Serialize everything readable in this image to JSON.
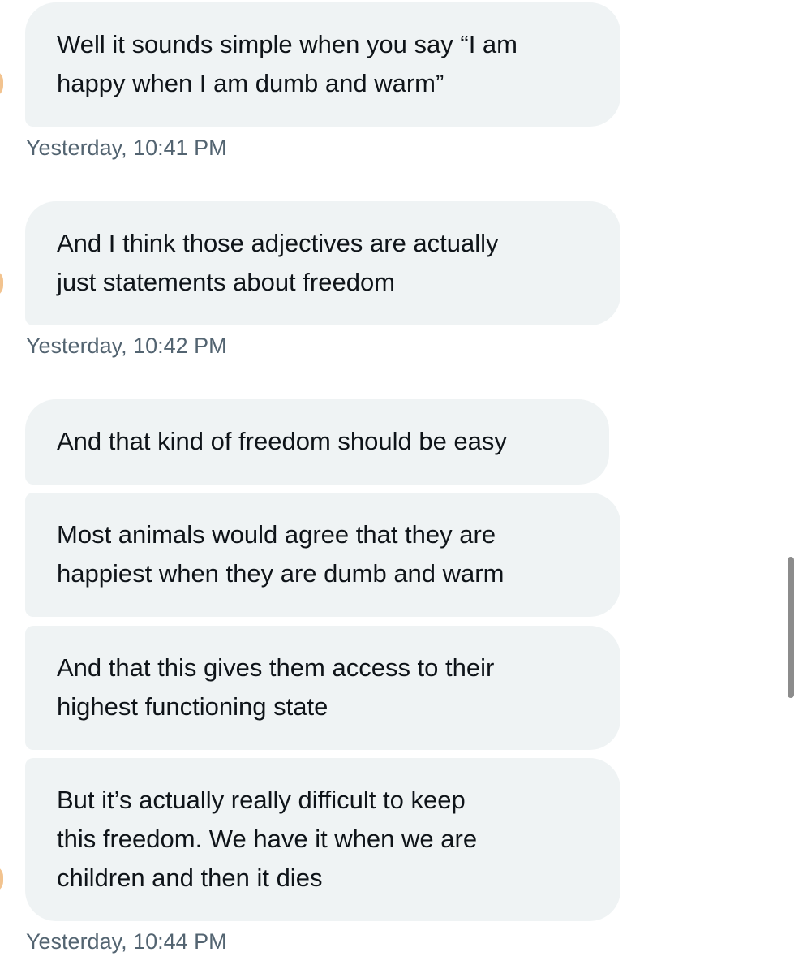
{
  "messages": [
    {
      "lines": [
        "Well it sounds simple when you say “I am",
        "happy when I am dumb and warm”"
      ],
      "timestamp": "Yesterday, 10:41 PM"
    },
    {
      "lines": [
        "And I think those adjectives are actually",
        "just statements about freedom"
      ],
      "timestamp": "Yesterday, 10:42 PM"
    },
    {
      "lines": [
        "And that kind of freedom should be easy"
      ]
    },
    {
      "lines": [
        "Most animals would agree that they are",
        "happiest when they are dumb and warm"
      ]
    },
    {
      "lines": [
        "And that this gives them access to their",
        "highest functioning state"
      ]
    },
    {
      "lines": [
        "But it’s actually really difficult to keep",
        "this freedom. We have it when we are",
        "children and then it dies"
      ],
      "timestamp": "Yesterday, 10:44 PM"
    }
  ],
  "colors": {
    "bubble_background": "#eff3f4",
    "message_text": "#0f1419",
    "timestamp_text": "#536471",
    "avatar_accent": "#f2c38f"
  }
}
